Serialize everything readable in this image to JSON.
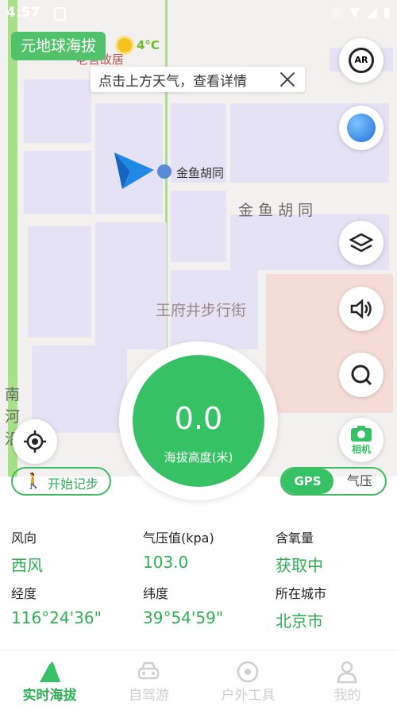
{
  "status_bar": {
    "time": "4:57"
  },
  "header": {
    "app_chip": "元地球海拔",
    "temperature": "4°C"
  },
  "tip": {
    "text": "点击上方天气，查看详情"
  },
  "map": {
    "poi_top": "老舍故居",
    "station": "金鱼胡同",
    "street": "金 鱼 胡 同",
    "walk_street": "王府井步行街",
    "river_lines": [
      "南",
      "河",
      "沿"
    ]
  },
  "side_buttons": {
    "ar": "AR",
    "camera": "相机"
  },
  "gauge": {
    "value": "0.0",
    "label": "海拔高度(米)"
  },
  "controls": {
    "start_record": "开始记步",
    "gps": "GPS",
    "pressure": "气压"
  },
  "info": [
    {
      "key": "风向",
      "value": "西风"
    },
    {
      "key": "气压值(kpa)",
      "value": "103.0"
    },
    {
      "key": "含氧量",
      "value": "获取中"
    },
    {
      "key": "经度",
      "value": "116°24'36\""
    },
    {
      "key": "纬度",
      "value": "39°54'59\""
    },
    {
      "key": "所在城市",
      "value": "北京市"
    }
  ],
  "tabs": [
    {
      "label": "实时海拔",
      "icon": "mountain-icon",
      "active": true
    },
    {
      "label": "自驾游",
      "icon": "car-icon",
      "active": false
    },
    {
      "label": "户外工具",
      "icon": "compass-icon",
      "active": false
    },
    {
      "label": "我的",
      "icon": "person-icon",
      "active": false
    }
  ],
  "colors": {
    "accent": "#36c164",
    "map_block": "#e4e2f4",
    "tab_inactive": "#cfcfcf"
  }
}
